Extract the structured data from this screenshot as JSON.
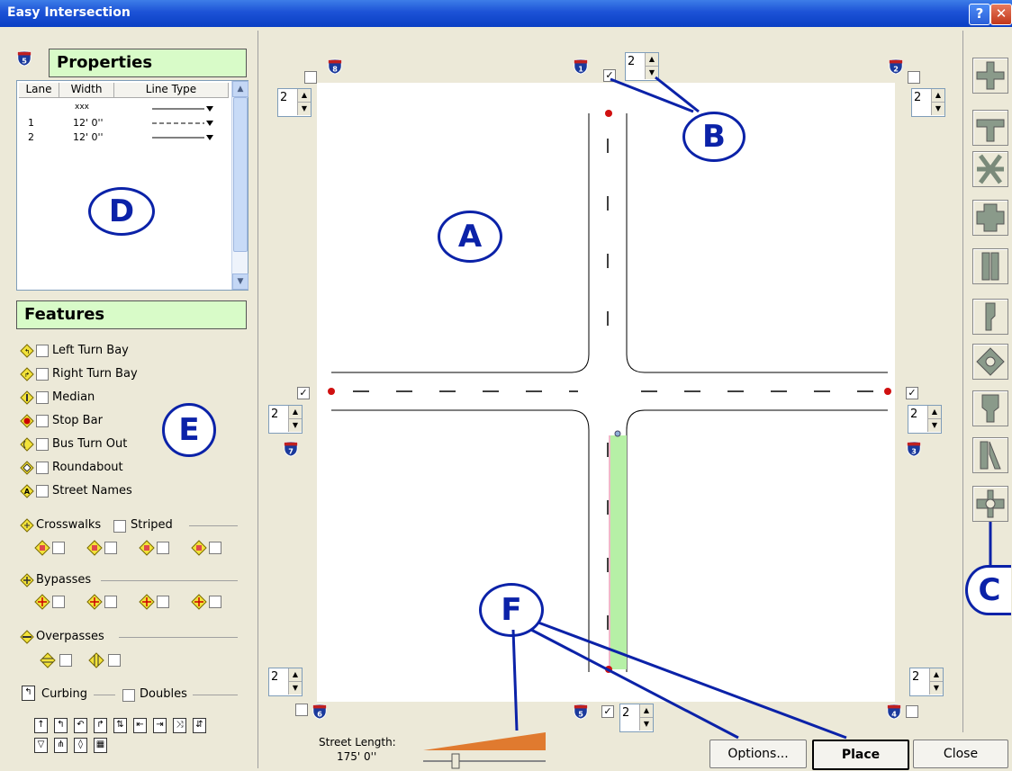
{
  "window": {
    "title": "Easy Intersection",
    "help_glyph": "?",
    "close_glyph": "✕"
  },
  "properties": {
    "title": "Properties",
    "shield_number": "5",
    "columns": [
      "Lane",
      "Width",
      "Line Type"
    ],
    "rows": [
      {
        "lane": "",
        "width": "xxx",
        "line": "solid"
      },
      {
        "lane": "1",
        "width": "12' 0''",
        "line": "dashed"
      },
      {
        "lane": "2",
        "width": "12' 0''",
        "line": "solid"
      }
    ]
  },
  "features": {
    "title": "Features",
    "items": [
      "Left Turn Bay",
      "Right Turn Bay",
      "Median",
      "Stop Bar",
      "Bus Turn Out",
      "Roundabout",
      "Street Names"
    ],
    "crosswalks_label": "Crosswalks",
    "striped_label": "Striped",
    "bypasses_label": "Bypasses",
    "overpasses_label": "Overpasses",
    "curbing_label": "Curbing",
    "doubles_label": "Doubles"
  },
  "legs": {
    "spin_value": "2",
    "shields": [
      "1",
      "2",
      "3",
      "4",
      "5",
      "6",
      "7",
      "8"
    ]
  },
  "bottom": {
    "street_length_label": "Street Length:",
    "street_length_value": "175' 0''",
    "options_label": "Options...",
    "place_label": "Place",
    "close_label": "Close"
  },
  "callouts": {
    "a": "A",
    "b": "B",
    "c": "C",
    "d": "D",
    "e": "E",
    "f": "F"
  },
  "colors": {
    "titlebar": "#0a3fc4",
    "green_header": "#d8fbc8",
    "callout": "#0b22a8",
    "slider": "#e07a2f",
    "lane_fill": "#b6f0a6"
  }
}
